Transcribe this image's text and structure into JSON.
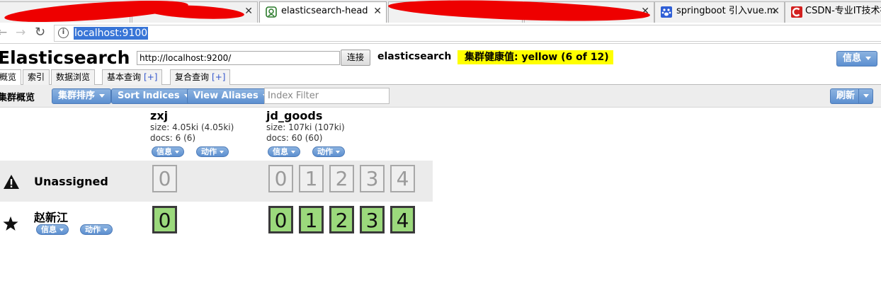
{
  "browser": {
    "tabs": [
      {
        "label": "",
        "active": false
      },
      {
        "label": "",
        "active": false
      },
      {
        "label": "elasticsearch-head",
        "active": true
      },
      {
        "label": "",
        "active": false
      },
      {
        "label": "",
        "active": false
      },
      {
        "label": "springboot 引入vue.m",
        "active": false
      },
      {
        "label": "CSDN-专业IT技术社",
        "active": false
      }
    ],
    "url": "localhost:9100"
  },
  "header": {
    "title": "Elasticsearch",
    "connection_url": "http://localhost:9200/",
    "connect_button": "连接",
    "cluster_name": "elasticsearch",
    "health_text": "集群健康值: yellow (6 of 12)",
    "info_button": "信息"
  },
  "app_tabs": [
    {
      "label": "概览",
      "plus": ""
    },
    {
      "label": "索引",
      "plus": ""
    },
    {
      "label": "数据浏览",
      "plus": ""
    },
    {
      "label": "基本查询",
      "plus": "[+]"
    },
    {
      "label": "复合查询",
      "plus": "[+]"
    }
  ],
  "toolbar": {
    "label": "集群概览",
    "sort_button": "集群排序",
    "sort_indices_button": "Sort Indices",
    "view_aliases_button": "View Aliases",
    "index_filter_placeholder": "Index Filter",
    "refresh_button": "刷新"
  },
  "indices": [
    {
      "name": "zxj",
      "size": "size: 4.05ki (4.05ki)",
      "docs": "docs: 6 (6)",
      "info_label": "信息",
      "action_label": "动作",
      "unassigned_shards": [
        "0"
      ],
      "node_shards": [
        "0"
      ]
    },
    {
      "name": "jd_goods",
      "size": "size: 107ki (107ki)",
      "docs": "docs: 60 (60)",
      "info_label": "信息",
      "action_label": "动作",
      "unassigned_shards": [
        "0",
        "1",
        "2",
        "3",
        "4"
      ],
      "node_shards": [
        "0",
        "1",
        "2",
        "3",
        "4"
      ]
    }
  ],
  "rows": {
    "unassigned_label": "Unassigned",
    "node_name": "赵新江",
    "node_info_label": "信息",
    "node_action_label": "动作"
  },
  "colors": {
    "health_yellow": "#ffff00",
    "shard_green": "#9bd97c",
    "button_blue": "#5c8fd0"
  }
}
